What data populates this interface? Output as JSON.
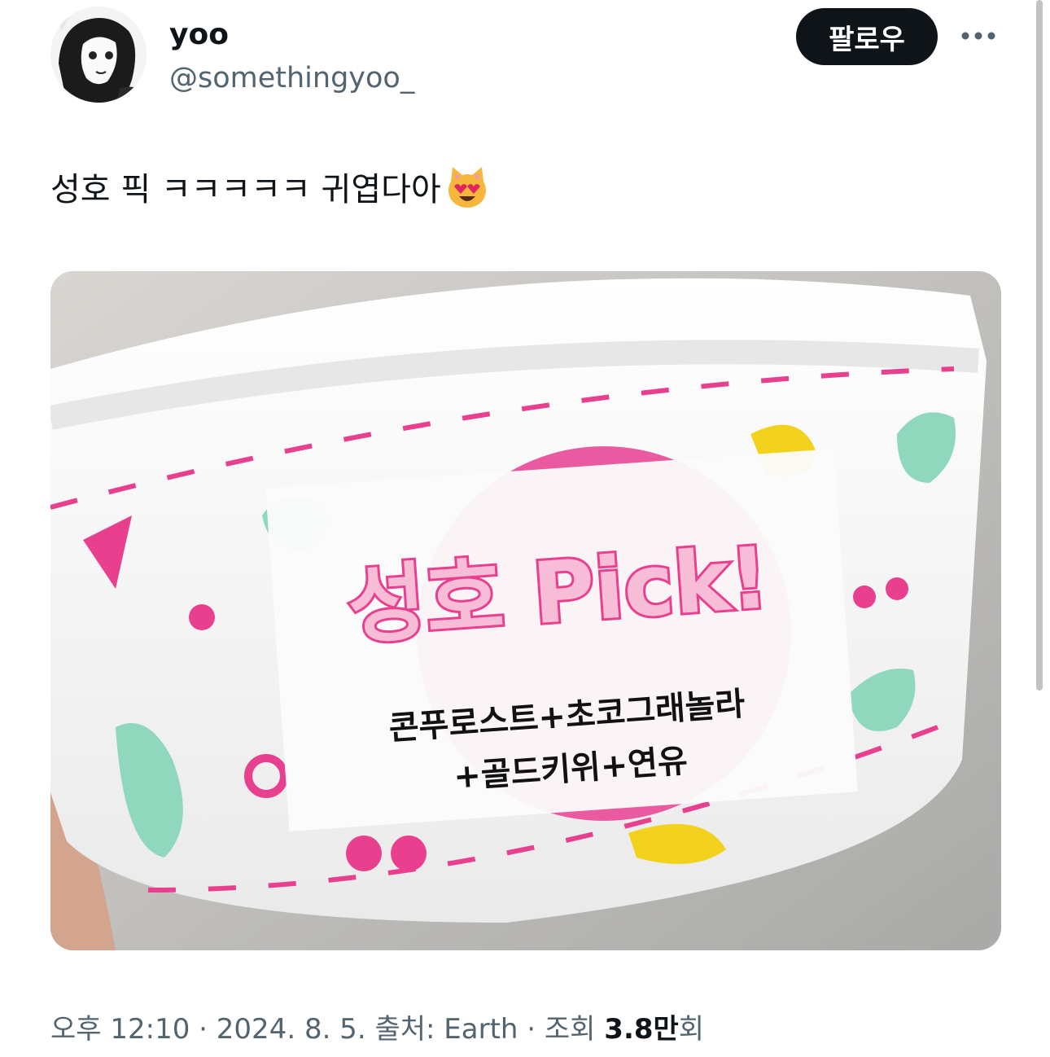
{
  "tweet": {
    "author": {
      "display_name": "yoo",
      "handle": "@somethingyoo_",
      "avatar_icon": "avatar-illustration"
    },
    "follow_label": "팔로우",
    "more_icon": "more-horizontal-icon",
    "text": "성호 픽 ㅋㅋㅋㅋㅋ 귀엽다아",
    "text_emoji": "heart-eyes-cat-emoji",
    "photo": {
      "sticker_title": "성호 Pick!",
      "sticker_line1": "콘푸로스트+초코그래놀라",
      "sticker_line2": "+골드키위+연유"
    },
    "meta": {
      "time": "오후 12:10",
      "separator": " · ",
      "date": "2024. 8. 5.",
      "source_label": "출처: ",
      "source": "Earth",
      "views_label": "조회 ",
      "views_count": "3.8",
      "views_unit": "만회"
    }
  },
  "colors": {
    "follow_bg": "#0f1419",
    "secondary_text": "#536471",
    "pink": "#e8408f",
    "mint": "#8fd8bd",
    "yellow": "#f3d21d"
  }
}
